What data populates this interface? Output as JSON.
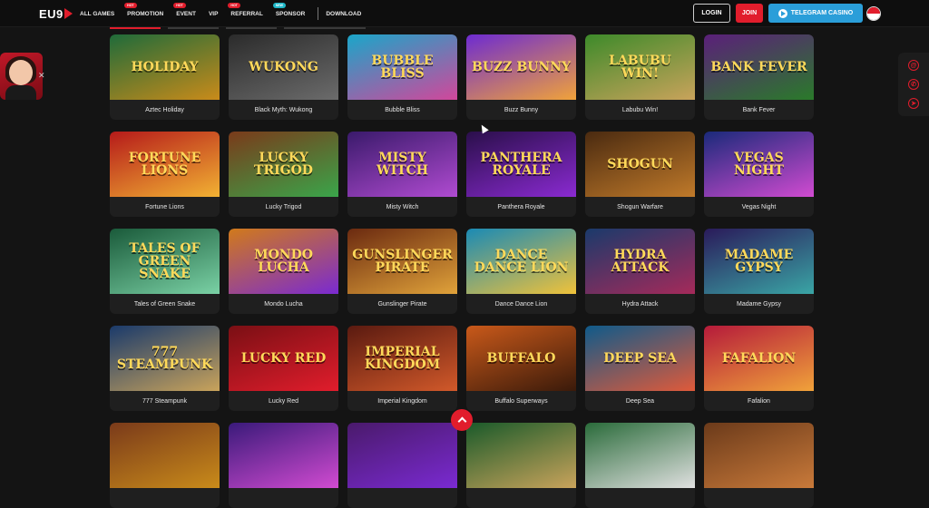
{
  "brand": {
    "logo_text": "EU9"
  },
  "nav": {
    "items": [
      {
        "label": "ALL GAMES",
        "badge": ""
      },
      {
        "label": "PROMOTION",
        "badge": "HOT"
      },
      {
        "label": "EVENT",
        "badge": "HOT"
      },
      {
        "label": "VIP",
        "badge": ""
      },
      {
        "label": "REFERRAL",
        "badge": "HOT"
      },
      {
        "label": "SPONSOR",
        "badge": "NEW"
      },
      {
        "label": "DOWNLOAD",
        "badge": ""
      }
    ]
  },
  "header_actions": {
    "login_label": "LOGIN",
    "join_label": "JOIN",
    "telegram_label": "TELEGRAM CASINO"
  },
  "colors": {
    "accent_red": "#e11d2c",
    "telegram_blue": "#2a9ed9",
    "card_bg": "#1f1f1f",
    "page_bg": "#141414"
  },
  "games": [
    {
      "name": "Aztec Holiday",
      "art_text": "HOLIDAY",
      "bg": [
        "#1f6b3a",
        "#c98b1a"
      ]
    },
    {
      "name": "Black Myth: Wukong",
      "art_text": "WUKONG",
      "bg": [
        "#2b2b2b",
        "#6b6b6b"
      ]
    },
    {
      "name": "Bubble Bliss",
      "art_text": "BUBBLE BLISS",
      "bg": [
        "#1aa6c9",
        "#d1479b"
      ]
    },
    {
      "name": "Buzz Bunny",
      "art_text": "BUZZ BUNNY",
      "bg": [
        "#6d2bd1",
        "#f0a23a"
      ]
    },
    {
      "name": "Labubu Win!",
      "art_text": "LABUBU WIN!",
      "bg": [
        "#3d8a2a",
        "#c9a35b"
      ]
    },
    {
      "name": "Bank Fever",
      "art_text": "BANK FEVER",
      "bg": [
        "#5b1f7a",
        "#2a7a2a"
      ]
    },
    {
      "name": "Fortune Lions",
      "art_text": "FORTUNE LIONS",
      "bg": [
        "#b51a1a",
        "#f2b233"
      ]
    },
    {
      "name": "Lucky Trigod",
      "art_text": "LUCKY TRIGOD",
      "bg": [
        "#7a3a1a",
        "#3aa54a"
      ]
    },
    {
      "name": "Misty Witch",
      "art_text": "MISTY WITCH",
      "bg": [
        "#3a1a6b",
        "#b04bd1"
      ]
    },
    {
      "name": "Panthera Royale",
      "art_text": "PANTHERA ROYALE",
      "bg": [
        "#2a0f4a",
        "#8a2ad1"
      ]
    },
    {
      "name": "Shogun Warfare",
      "art_text": "SHOGUN",
      "bg": [
        "#4a2a10",
        "#c07a2a"
      ]
    },
    {
      "name": "Vegas Night",
      "art_text": "VEGAS NIGHT",
      "bg": [
        "#1a2a7a",
        "#d14bd1"
      ]
    },
    {
      "name": "Tales of Green Snake",
      "art_text": "TALES OF GREEN SNAKE",
      "bg": [
        "#1a5a3a",
        "#7ad1a5"
      ]
    },
    {
      "name": "Mondo Lucha",
      "art_text": "MONDO LUCHA",
      "bg": [
        "#d17a1a",
        "#7a2ad1"
      ]
    },
    {
      "name": "Gunslinger Pirate",
      "art_text": "GUNSLINGER PIRATE",
      "bg": [
        "#6b2a10",
        "#e0a23a"
      ]
    },
    {
      "name": "Dance Dance Lion",
      "art_text": "DANCE DANCE LION",
      "bg": [
        "#1a8ab5",
        "#f0c23a"
      ]
    },
    {
      "name": "Hydra Attack",
      "art_text": "HYDRA ATTACK",
      "bg": [
        "#1a3a6b",
        "#a52a5a"
      ]
    },
    {
      "name": "Madame Gypsy",
      "art_text": "MADAME GYPSY",
      "bg": [
        "#2a1a5a",
        "#3aa5a5"
      ]
    },
    {
      "name": "777 Steampunk",
      "art_text": "777 STEAMPUNK",
      "bg": [
        "#1a3a6b",
        "#c9a35b"
      ]
    },
    {
      "name": "Lucky Red",
      "art_text": "LUCKY RED",
      "bg": [
        "#7a0f14",
        "#e11d2c"
      ]
    },
    {
      "name": "Imperial Kingdom",
      "art_text": "IMPERIAL KINGDOM",
      "bg": [
        "#5a1a10",
        "#d1592a"
      ]
    },
    {
      "name": "Buffalo Superways",
      "art_text": "BUFFALO",
      "bg": [
        "#c9591a",
        "#3a1a0a"
      ]
    },
    {
      "name": "Deep Sea",
      "art_text": "DEEP SEA",
      "bg": [
        "#0f5a8a",
        "#e05a3a"
      ]
    },
    {
      "name": "Fafalion",
      "art_text": "FAFALION",
      "bg": [
        "#b51a3a",
        "#f0a23a"
      ]
    },
    {
      "name": "",
      "art_text": "",
      "bg": [
        "#7a3a1a",
        "#c98b1a"
      ]
    },
    {
      "name": "",
      "art_text": "",
      "bg": [
        "#3a1a7a",
        "#d14bd1"
      ]
    },
    {
      "name": "",
      "art_text": "",
      "bg": [
        "#4a1a6b",
        "#7a2ad1"
      ]
    },
    {
      "name": "",
      "art_text": "",
      "bg": [
        "#1a5a2a",
        "#c9a35b"
      ]
    },
    {
      "name": "",
      "art_text": "",
      "bg": [
        "#2a6b3a",
        "#e0e0e0"
      ]
    },
    {
      "name": "",
      "art_text": "",
      "bg": [
        "#6b3a1a",
        "#c97a3a"
      ]
    }
  ]
}
